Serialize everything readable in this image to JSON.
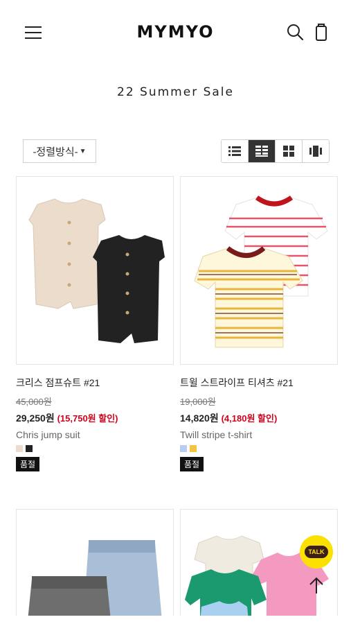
{
  "header": {
    "logo": "MYMYO",
    "menu_icon": "hamburger-icon",
    "search_icon": "search-icon",
    "cart_icon": "shopping-bag-icon"
  },
  "page_title": "22 Summer Sale",
  "toolbar": {
    "sort_label": "-정렬방식-",
    "view_options": [
      "list-view-icon",
      "grid-2-view-icon",
      "grid-4-view-icon",
      "slide-view-icon"
    ],
    "active_view": "grid-2-view-icon"
  },
  "products": [
    {
      "name": "크리스 점프슈트 #21",
      "original_price": "45,000원",
      "sale_price": "29,250원",
      "discount": "(15,750원 할인)",
      "english_name": "Chris jump suit",
      "colors": [
        "#ecdccb",
        "#222222"
      ],
      "badge": "품절"
    },
    {
      "name": "트윌 스트라이프 티셔츠 #21",
      "original_price": "19,000원",
      "sale_price": "14,820원",
      "discount": "(4,180원 할인)",
      "english_name": "Twill stripe t-shirt",
      "colors": [
        "#b9cdf0",
        "#f4c542"
      ],
      "badge": "품절"
    }
  ],
  "floating": {
    "talk_label": "TALK",
    "top_icon": "arrow-up-icon"
  },
  "colors": {
    "discount": "#d0021b",
    "talk_bg": "#fae100"
  }
}
